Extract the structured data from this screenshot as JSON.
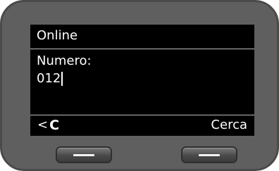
{
  "status": {
    "text": "Online"
  },
  "field": {
    "label": "Numero:",
    "value": "012"
  },
  "softkeys": {
    "left_icon": "backspace-arrow-icon",
    "left_label": "C",
    "right_label": "Cerca"
  },
  "colors": {
    "screen_bg": "#000000",
    "screen_text": "#ffffff",
    "device_body": "#5f5f5f"
  }
}
